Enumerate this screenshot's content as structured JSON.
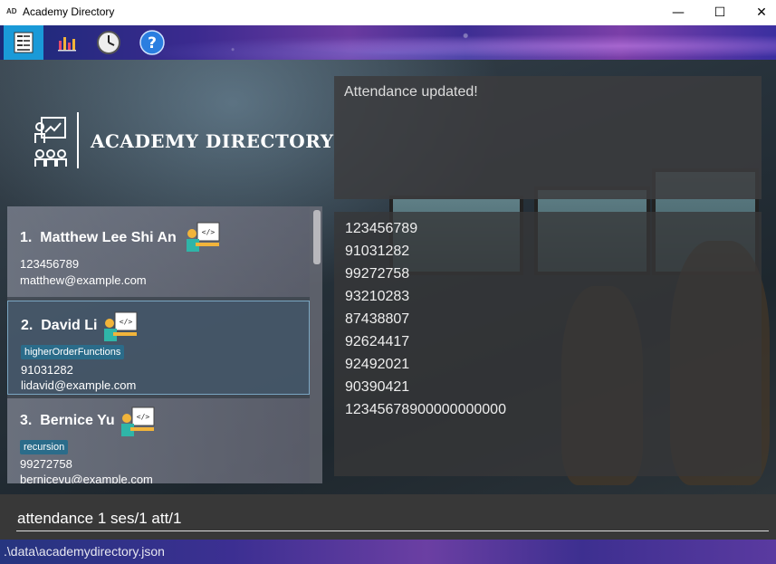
{
  "window": {
    "app_icon_text": "AD",
    "title": "Academy Directory",
    "minimize": "—",
    "maximize": "☐",
    "close": "✕"
  },
  "toolbar": {
    "items": [
      {
        "name": "student-view",
        "icon": "student-list-icon",
        "active": true
      },
      {
        "name": "statistics",
        "icon": "chart-icon"
      },
      {
        "name": "history",
        "icon": "clock-icon"
      },
      {
        "name": "help",
        "icon": "help-icon",
        "label": "?"
      }
    ],
    "active_color": "#1a9ad8"
  },
  "logo": {
    "text": "ACADEMY DIRECTORY",
    "icon": "teacher-presentation-icon"
  },
  "students": [
    {
      "index": "1.",
      "name": "Matthew Lee Shi An",
      "tags": [],
      "phone": "123456789",
      "email": "matthew@example.com"
    },
    {
      "index": "2.",
      "name": "David Li",
      "tags": [
        "higherOrderFunctions"
      ],
      "phone": "91031282",
      "email": "lidavid@example.com",
      "selected": true
    },
    {
      "index": "3.",
      "name": "Bernice Yu",
      "tags": [
        "recursion"
      ],
      "phone": "99272758",
      "email": "bernicevu@example.com"
    }
  ],
  "result": {
    "message": "Attendance updated!"
  },
  "data_view": {
    "lines": [
      "123456789",
      "91031282",
      "99272758",
      "93210283",
      "87438807",
      "92624417",
      "92492021",
      "90390421",
      "12345678900000000000"
    ]
  },
  "command": {
    "value": "attendance 1 ses/1 att/1"
  },
  "status": {
    "path": ".\\data\\academydirectory.json"
  },
  "colors": {
    "tag": "#2b6c8a",
    "selected_border": "#7aa6c2"
  }
}
